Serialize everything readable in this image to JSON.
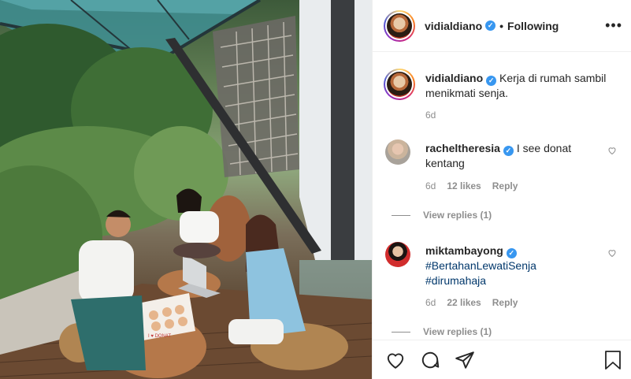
{
  "post": {
    "author": "vidialdiano",
    "follow_status": "Following",
    "more_icon": "more-options-icon",
    "caption": "Kerja di rumah sambil menikmati senja.",
    "caption_time": "6d",
    "photo_label": "I ♥ DONAT",
    "verified_mark": "✓",
    "separator": "•"
  },
  "comments": [
    {
      "username": "racheltheresia",
      "text": "I see donat kentang",
      "time": "6d",
      "likes": "12 likes",
      "reply": "Reply",
      "view_replies": "View replies (1)"
    },
    {
      "username": "miktambayong",
      "hashtags": [
        "#BertahanLewatiSenja",
        "#dirumahaja"
      ],
      "time": "6d",
      "likes": "22 likes",
      "reply": "Reply",
      "view_replies": "View replies (1)"
    }
  ],
  "actions": {
    "like_icon": "heart-icon",
    "comment_icon": "comment-icon",
    "share_icon": "share-icon",
    "save_icon": "bookmark-icon"
  },
  "colors": {
    "link": "#00376b",
    "verified": "#3897f0",
    "muted": "#8e8e8e",
    "text": "#262626"
  }
}
